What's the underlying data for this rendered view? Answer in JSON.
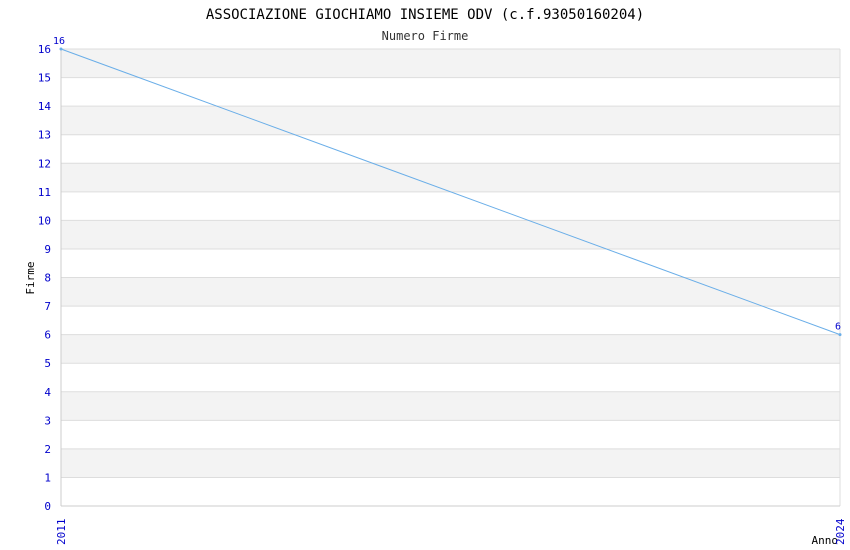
{
  "chart_data": {
    "type": "line",
    "title": "ASSOCIAZIONE GIOCHIAMO INSIEME ODV (c.f.93050160204)",
    "subtitle": "Numero Firme",
    "xlabel": "Anno",
    "ylabel": "Firme",
    "x": [
      "2011",
      "2024"
    ],
    "series": [
      {
        "values": [
          16,
          6
        ]
      }
    ],
    "ylim": [
      0,
      16
    ],
    "yticks": [
      "0",
      "1",
      "2",
      "3",
      "4",
      "5",
      "6",
      "7",
      "8",
      "9",
      "10",
      "11",
      "12",
      "13",
      "14",
      "15",
      "16"
    ],
    "data_labels": [
      "16",
      "6"
    ],
    "grid": true,
    "colors": {
      "line": "#6aaee8",
      "tick_text": "#0000cc",
      "band_alt": "#f3f3f3",
      "band": "#ffffff",
      "grid": "#dddddd"
    }
  }
}
